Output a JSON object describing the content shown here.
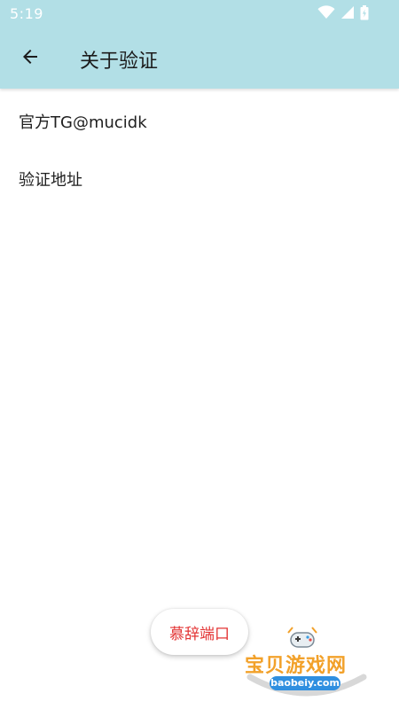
{
  "status_bar": {
    "time": "5:19",
    "icons": [
      "wifi-icon",
      "signal-icon",
      "battery-icon"
    ]
  },
  "app_bar": {
    "title": "关于验证",
    "background": "#b2dfe6",
    "back_icon": "arrow-left-icon"
  },
  "list": {
    "items": [
      {
        "label": "官方TG@mucidk"
      },
      {
        "label": "验证地址"
      }
    ]
  },
  "fab": {
    "label": "慕辞端口",
    "text_color": "#e33434"
  },
  "watermark": {
    "title": "宝贝游戏网",
    "url": "baobeiy.com",
    "icon": "gamepad-icon"
  }
}
